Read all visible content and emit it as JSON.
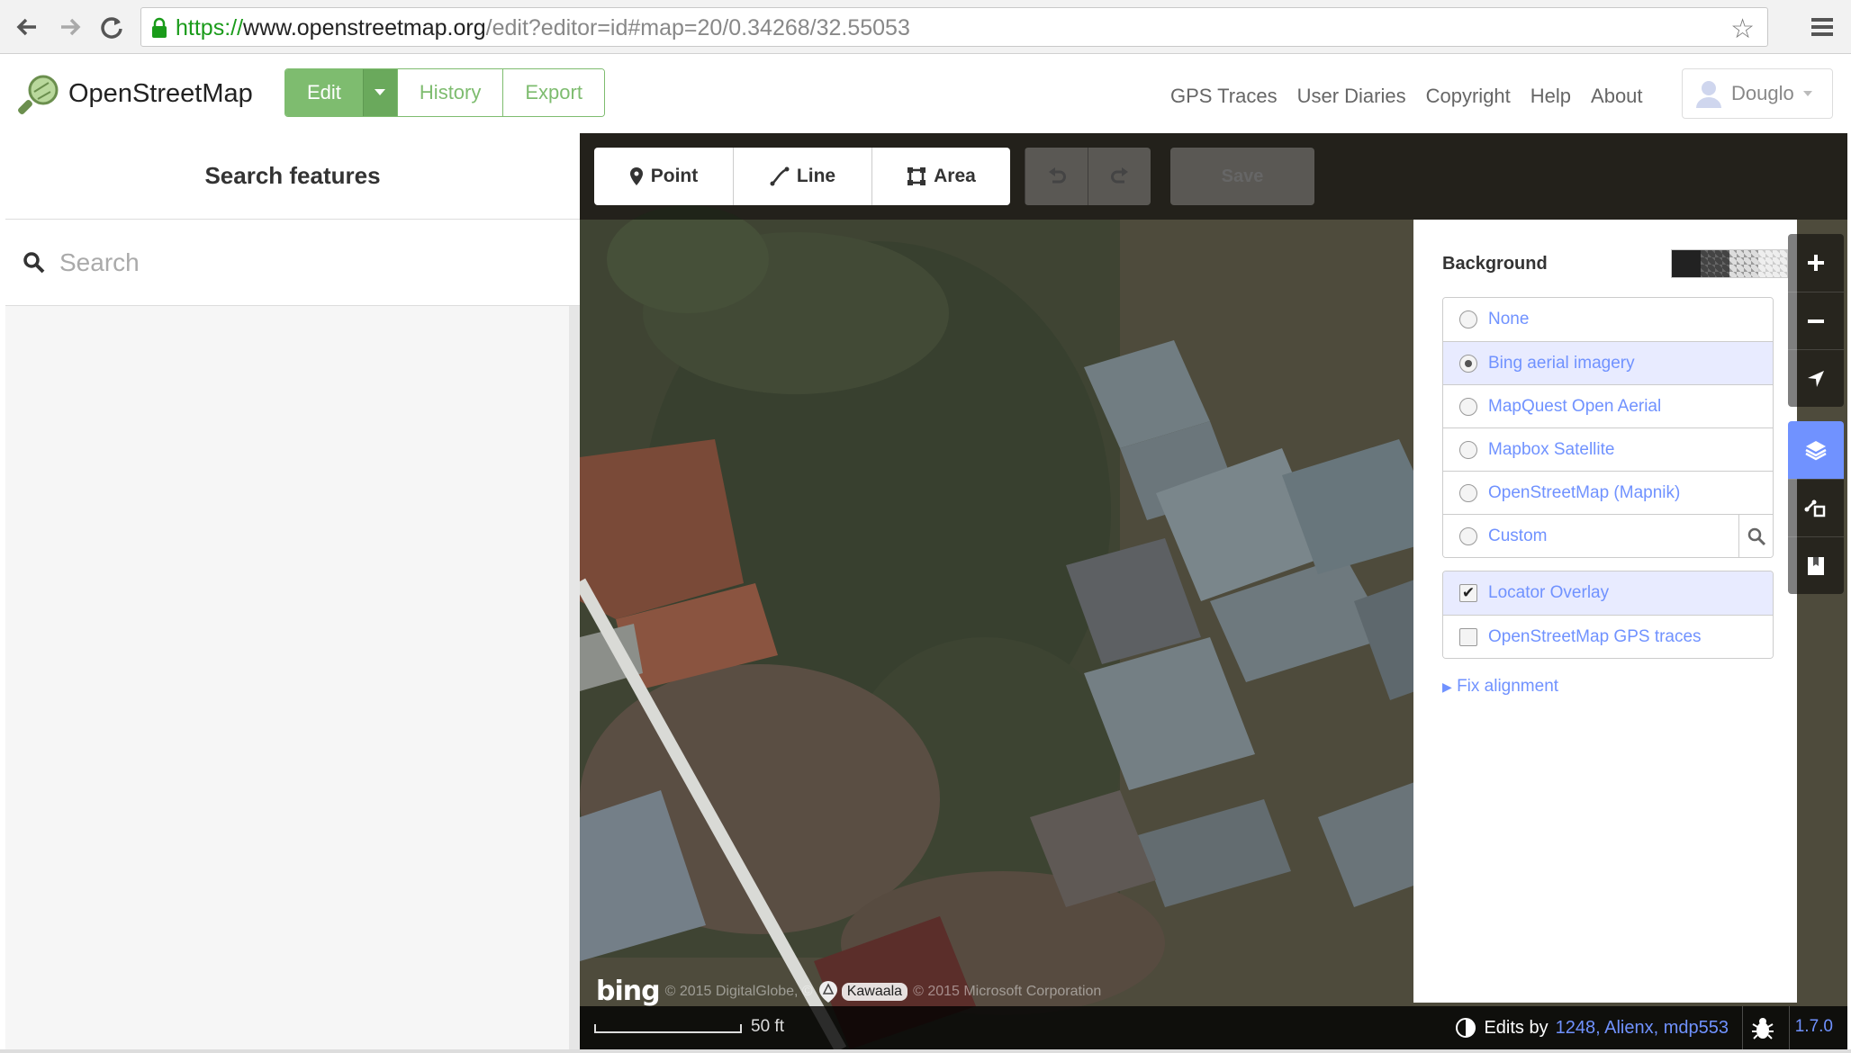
{
  "browser": {
    "url_protocol": "https://",
    "url_host": "www.openstreetmap.org",
    "url_rest": "/edit?editor=id#map=20/0.34268/32.55053"
  },
  "header": {
    "brand": "OpenStreetMap",
    "buttons": {
      "edit": "Edit",
      "history": "History",
      "export": "Export"
    },
    "links": [
      "GPS Traces",
      "User Diaries",
      "Copyright",
      "Help",
      "About"
    ],
    "user": "Douglo"
  },
  "sidebar": {
    "title": "Search features",
    "search_placeholder": "Search"
  },
  "toolbar": {
    "point": "Point",
    "line": "Line",
    "area": "Area",
    "save": "Save"
  },
  "background_pane": {
    "title": "Background",
    "layers": [
      {
        "label": "None",
        "selected": false
      },
      {
        "label": "Bing aerial imagery",
        "selected": true
      },
      {
        "label": "MapQuest Open Aerial",
        "selected": false
      },
      {
        "label": "Mapbox Satellite",
        "selected": false
      },
      {
        "label": "OpenStreetMap (Mapnik)",
        "selected": false
      },
      {
        "label": "Custom",
        "selected": false
      }
    ],
    "overlays": [
      {
        "label": "Locator Overlay",
        "checked": true
      },
      {
        "label": "OpenStreetMap GPS traces",
        "checked": false
      }
    ],
    "fix_alignment": "Fix alignment"
  },
  "map": {
    "attribution_bing": "bing",
    "attribution_left": "© 2015 DigitalGlobe, ©",
    "attribution_right": "© 2015 Microsoft Corporation",
    "place_label": "Kawaala",
    "scale_label": "50 ft",
    "edits_by_prefix": "Edits by",
    "edits_by_users": "1248, Alienx, mdp553",
    "version": "1.7.0"
  },
  "colors": {
    "osm_green": "#7ebc6f",
    "id_blue": "#7092ff",
    "selected_row": "#e8ebff"
  }
}
